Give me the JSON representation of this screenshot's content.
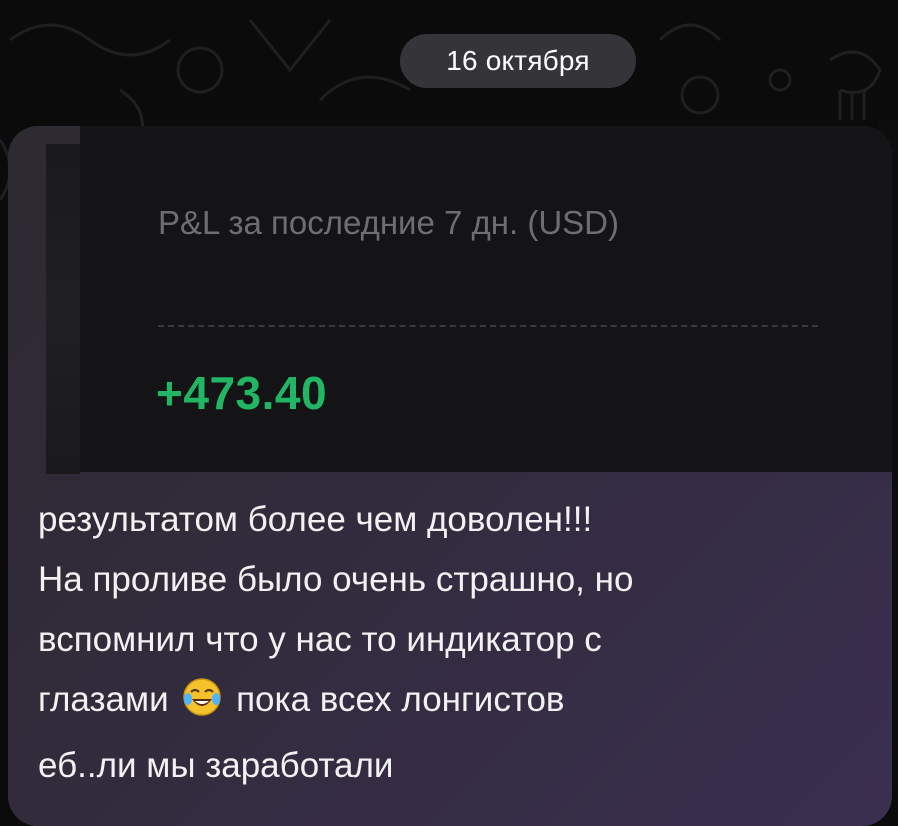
{
  "chat": {
    "date_label": "16 октября",
    "message": {
      "media": {
        "title": "P&L за последние 7 дн. (USD)",
        "value": "+473.40",
        "value_color": "#21b663"
      },
      "caption_lines": [
        "результатом более чем доволен!!!",
        "На проливе было очень страшно, но",
        "вспомнил что у нас то индикатор с",
        "глазами",
        "пока всех лонгистов",
        "еб..ли мы заработали"
      ],
      "emoji": "face-with-tears-of-joy"
    }
  }
}
